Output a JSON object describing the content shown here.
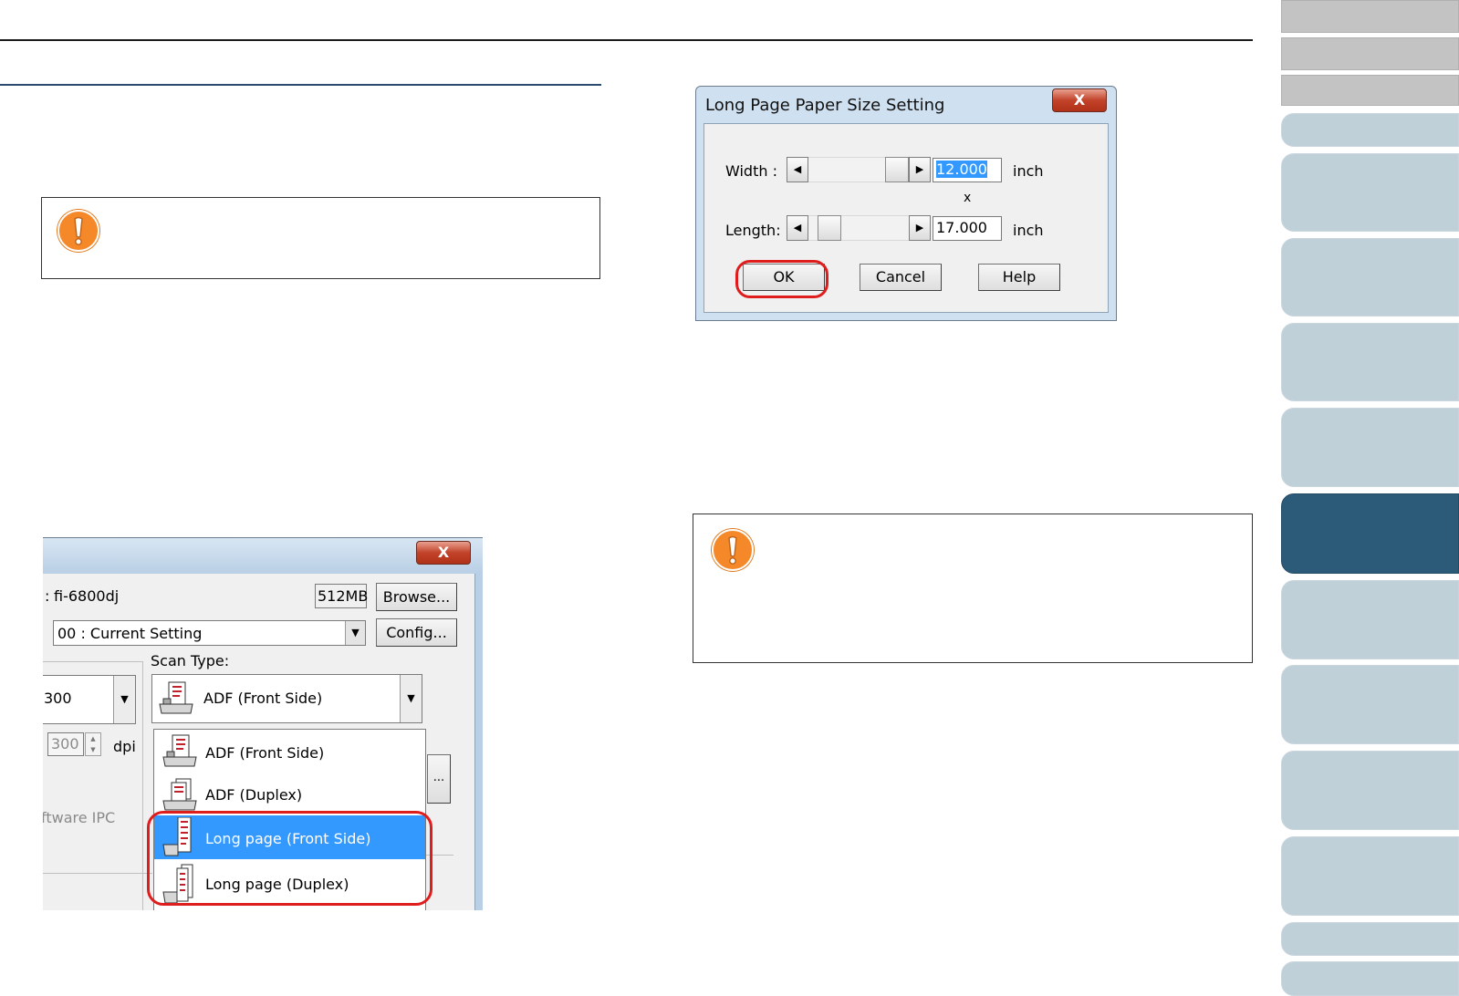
{
  "dialog_long_page": {
    "title": "Long Page Paper Size Setting",
    "close_label": "X",
    "width_label": "Width :",
    "width_value": "12.000",
    "width_unit": "inch",
    "times_label": "x",
    "length_label": "Length:",
    "length_value": "17.000",
    "length_unit": "inch",
    "ok_label": "OK",
    "cancel_label": "Cancel",
    "help_label": "Help"
  },
  "scanner_dialog": {
    "close_label": "X",
    "scanner_prefix": ":",
    "scanner_name": "fi-6800dj",
    "memory": "512MB",
    "browse_label": "Browse...",
    "setting_value": "00 : Current Setting",
    "config_label": "Config...",
    "scan_type_label": "Scan Type:",
    "resolution_value": "300",
    "scan_type_value": "ADF (Front Side)",
    "custom_resolution": "300",
    "dpi_label": "dpi",
    "more_label": "...",
    "software_label": "ftware IPC",
    "scan_type_options": [
      "ADF (Front Side)",
      "ADF (Duplex)",
      "Long page (Front Side)",
      "Long page (Duplex)"
    ],
    "selected_option": "Long page (Front Side)"
  },
  "colors": {
    "accent_nav": "#2c5b79",
    "nav_tab": "#bfd0d9",
    "warning": "#f5892a",
    "highlight": "#e01d1d",
    "selection": "#3399ff"
  }
}
